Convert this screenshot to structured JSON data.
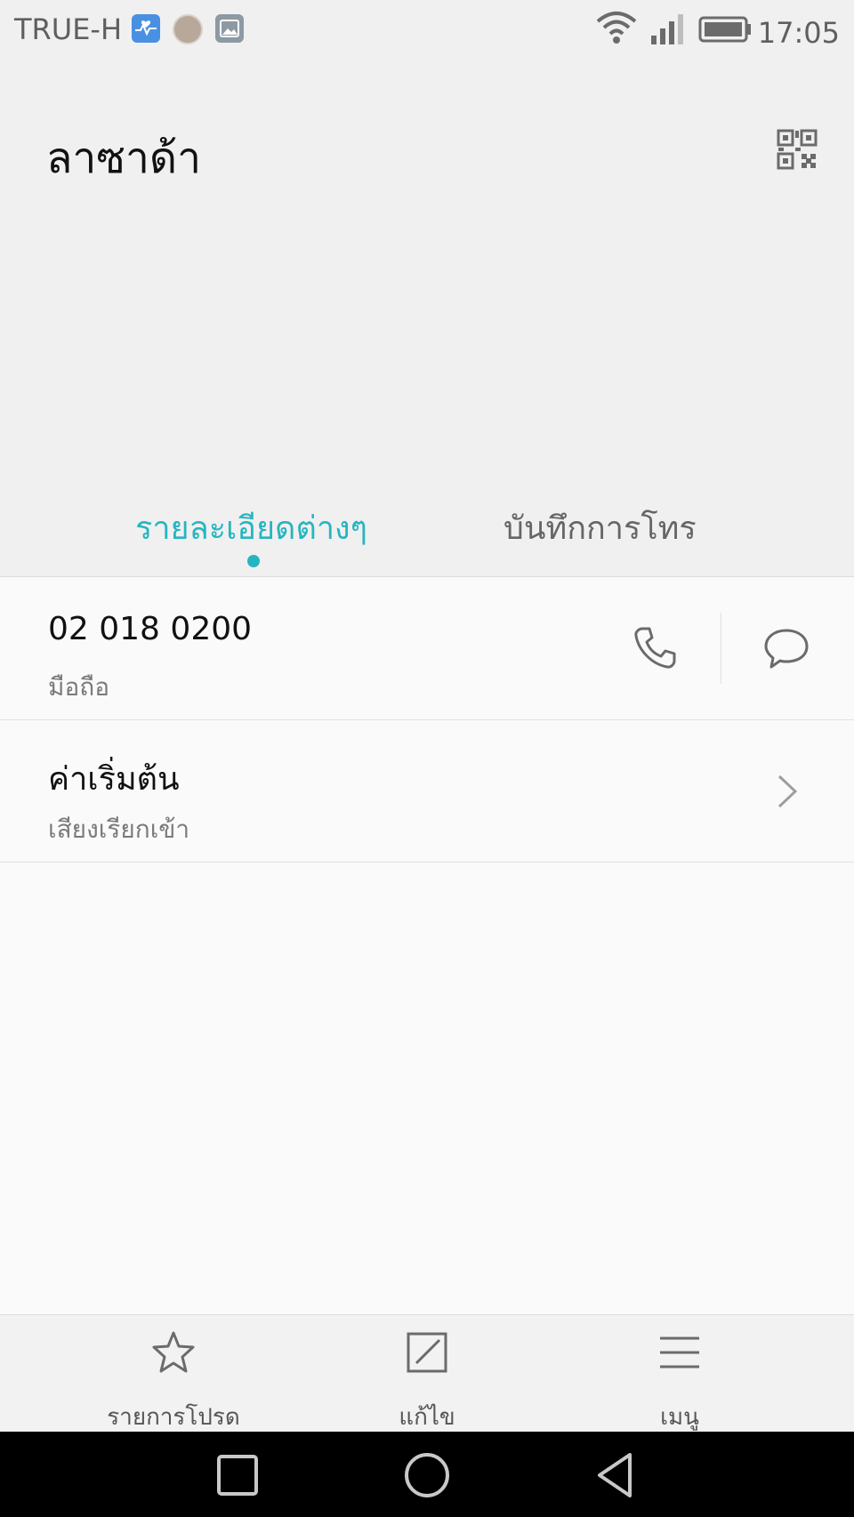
{
  "status_bar": {
    "carrier": "TRUE-H",
    "time": "17:05",
    "icons": [
      "health-app-icon",
      "avatar-icon",
      "gallery-icon",
      "wifi-icon",
      "signal-icon",
      "battery-icon"
    ]
  },
  "header": {
    "contact_name": "ลาซาด้า",
    "qr_icon": "qr-code-icon"
  },
  "tabs": [
    {
      "label": "รายละเอียดต่างๆ",
      "active": true
    },
    {
      "label": "บันทึกการโทร",
      "active": false
    }
  ],
  "details": {
    "phone": {
      "number": "02 018 0200",
      "type": "มือถือ"
    },
    "ringtone": {
      "title": "ค่าเริ่มต้น",
      "subtitle": "เสียงเรียกเข้า"
    }
  },
  "toolbar": {
    "favorites_label": "รายการโปรด",
    "edit_label": "แก้ไข",
    "menu_label": "เมนู"
  },
  "colors": {
    "accent": "#26b5c0",
    "background": "#f0f0f0",
    "content_bg": "#fafafa",
    "icon": "#6b6b6b"
  }
}
